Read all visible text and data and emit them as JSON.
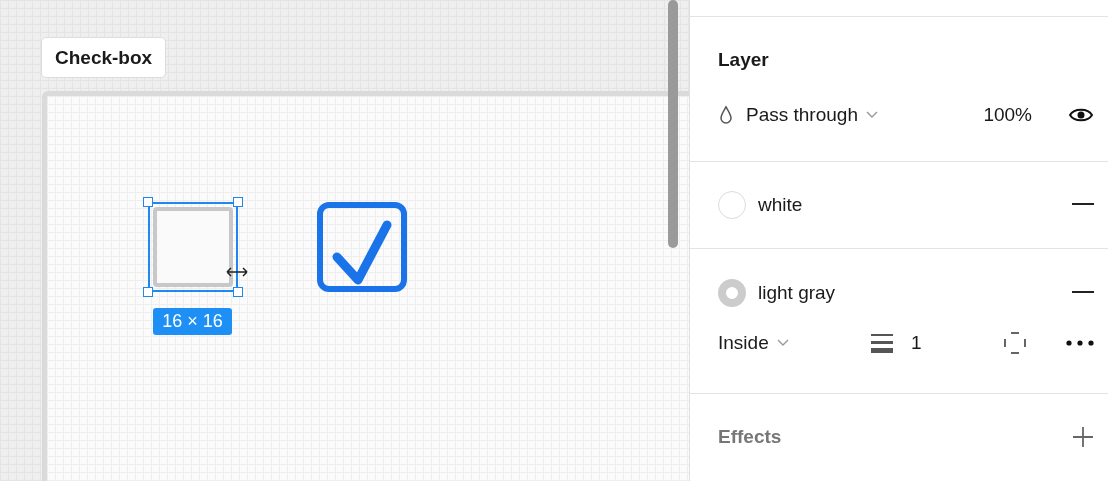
{
  "canvas": {
    "frame_label": "Check-box",
    "items": [
      {
        "kind": "unchecked",
        "selected": true,
        "size_label": "16 × 16"
      },
      {
        "kind": "checked",
        "selected": false
      }
    ]
  },
  "panel": {
    "layer": {
      "title": "Layer",
      "blend_mode": "Pass through",
      "opacity": "100%",
      "visible": true
    },
    "fills": [
      {
        "kind": "fill",
        "name": "white",
        "color": "#ffffff"
      },
      {
        "kind": "stroke",
        "name": "light gray",
        "color": "#cccccc"
      }
    ],
    "stroke": {
      "position": "Inside",
      "weight": "1"
    },
    "effects": {
      "title": "Effects"
    }
  }
}
